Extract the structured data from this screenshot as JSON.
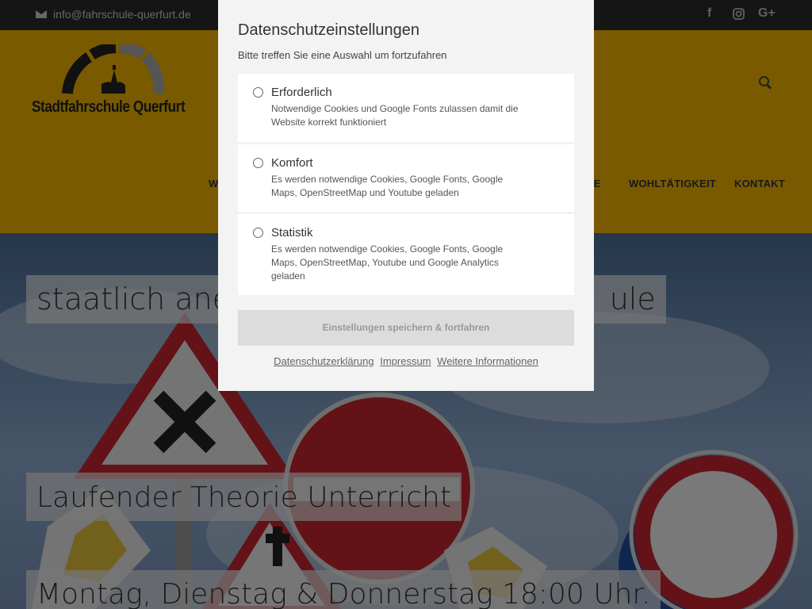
{
  "topbar": {
    "email": "info@fahrschule-querfurt.de",
    "social": [
      {
        "icon": "facebook-icon",
        "glyph": "f"
      },
      {
        "icon": "instagram-icon",
        "glyph": ""
      },
      {
        "icon": "google-plus-icon",
        "glyph": "G+"
      }
    ]
  },
  "header": {
    "logo_text": "Stadtfahrschule Querfurt",
    "nav": [
      "W",
      "IE",
      "WOHLTÄTIGKEIT",
      "KONTAKT"
    ]
  },
  "hero": {
    "line1": "staatlich aner",
    "line1_end": "ule",
    "line2": "Laufender Theorie Unterricht",
    "line3": "Montag, Dienstag & Donnerstag 18:00 Uhr."
  },
  "modal": {
    "title": "Datenschutzeinstellungen",
    "subtitle": "Bitte treffen Sie eine Auswahl um fortzufahren",
    "options": [
      {
        "label": "Erforderlich",
        "description": "Notwendige Cookies und Google Fonts zulassen damit die Website korrekt funktioniert"
      },
      {
        "label": "Komfort",
        "description": "Es werden notwendige Cookies, Google Fonts, Google Maps, OpenStreetMap und Youtube geladen"
      },
      {
        "label": "Statistik",
        "description": "Es werden notwendige Cookies, Google Fonts, Google Maps, OpenStreetMap, Youtube und Google Analytics geladen"
      }
    ],
    "save_label": "Einstellungen speichern & fortfahren",
    "links": [
      "Datenschutzerklärung",
      "Impressum",
      "Weitere Informationen"
    ]
  }
}
